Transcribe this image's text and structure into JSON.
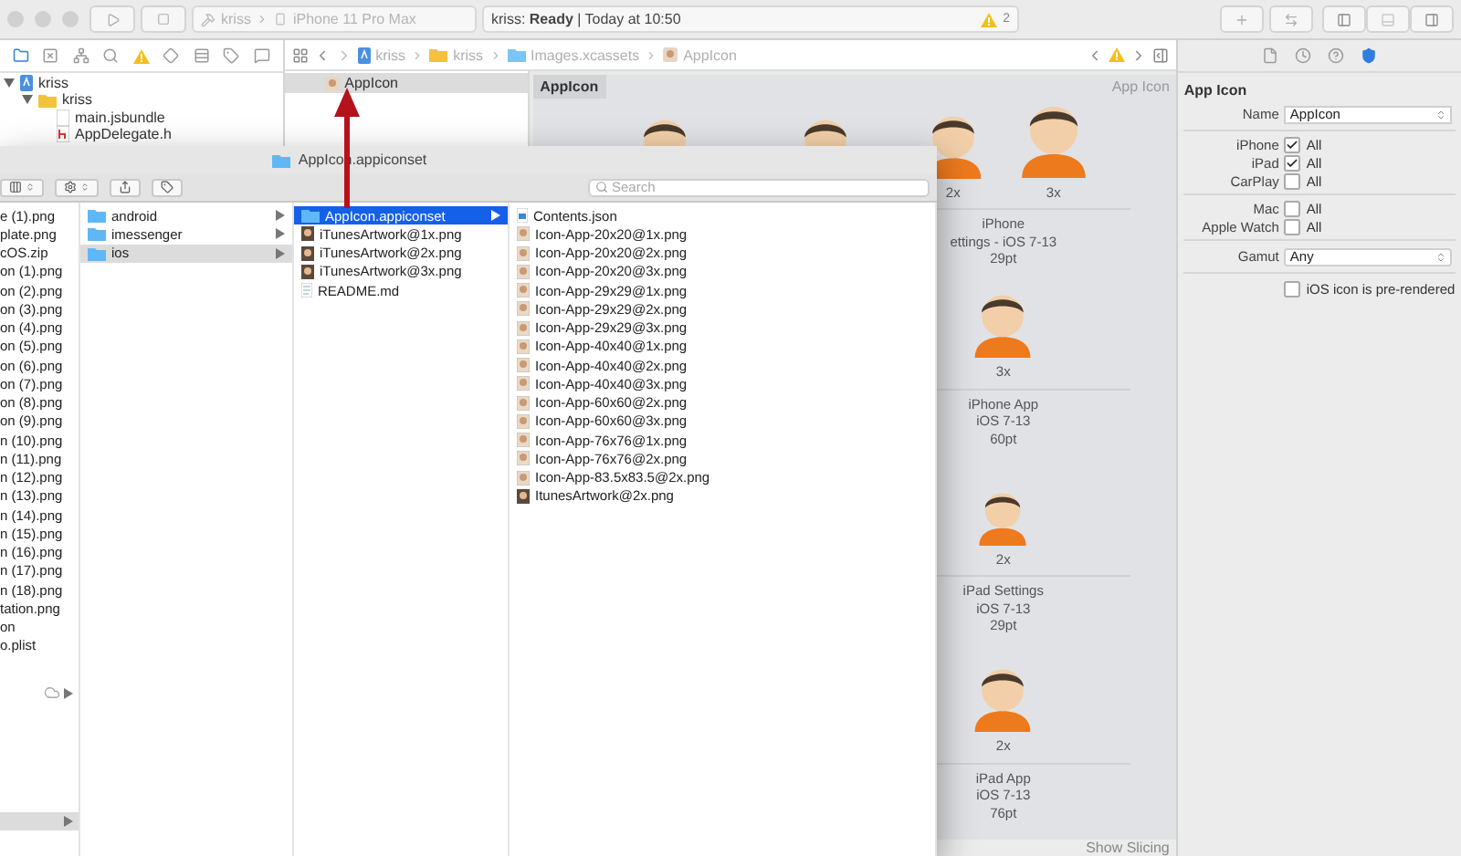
{
  "toolbar": {
    "scheme": "kriss",
    "device": "iPhone 11 Pro Max",
    "status": "kriss: **Ready** | Today at 10:50",
    "warning_count": "2",
    "panel_toggles": [
      {
        "kind": "navigator",
        "on": true
      },
      {
        "kind": "debug",
        "on": false
      },
      {
        "kind": "inspector",
        "on": true
      }
    ]
  },
  "navigator": {
    "tree": [
      {
        "name": "kriss",
        "kind": "project",
        "expanded": true,
        "children": [
          {
            "name": "kriss",
            "kind": "folder",
            "expanded": true,
            "children": [
              {
                "name": "main.jsbundle",
                "kind": "file"
              },
              {
                "name": "AppDelegate.h",
                "kind": "header"
              }
            ]
          }
        ]
      }
    ]
  },
  "jump_bar": {
    "path": [
      {
        "name": "kriss",
        "kind": "project"
      },
      {
        "name": "kriss",
        "kind": "folder"
      },
      {
        "name": "Images.xcassets",
        "kind": "assets"
      },
      {
        "name": "AppIcon",
        "kind": "appicon"
      }
    ]
  },
  "asset_list": [
    {
      "name": "AppIcon",
      "selected": true
    }
  ],
  "asset_detail": {
    "tab": "AppIcon",
    "type_label": "App Icon",
    "footer_button": "Show Slicing",
    "sets": [
      {
        "scales": [
          "2x",
          "3x"
        ],
        "caption": [
          "iPhone",
          "ettings - iOS 7-13",
          "29pt"
        ]
      },
      {
        "scales": [
          "3x"
        ],
        "caption": [
          "iPhone App",
          "iOS 7-13",
          "60pt"
        ]
      },
      {
        "scales": [
          "2x"
        ],
        "caption": [
          "iPad Settings",
          "iOS 7-13",
          "29pt"
        ]
      },
      {
        "scales": [
          "2x"
        ],
        "caption": [
          "iPad App",
          "iOS 7-13",
          "76pt"
        ]
      }
    ]
  },
  "inspector": {
    "section": "App Icon",
    "name_label": "Name",
    "name_value": "AppIcon",
    "platforms": [
      {
        "label": "iPhone",
        "option": "All",
        "checked": true
      },
      {
        "label": "iPad",
        "option": "All",
        "checked": true
      },
      {
        "label": "CarPlay",
        "option": "All",
        "checked": false
      },
      {
        "label": "Mac",
        "option": "All",
        "checked": false
      },
      {
        "label": "Apple Watch",
        "option": "All",
        "checked": false
      }
    ],
    "gamut_label": "Gamut",
    "gamut_value": "Any",
    "prerendered": {
      "label": "iOS icon is pre-rendered",
      "checked": false
    }
  },
  "finder": {
    "title": "AppIcon.appiconset",
    "search_placeholder": "Search",
    "columns": [
      {
        "focused": false,
        "highlighted_row": true,
        "items": [
          {
            "name": "e (1).png",
            "kind": "partial",
            "selected": false
          },
          {
            "name": "plate.png",
            "kind": "partial",
            "selected": false
          },
          {
            "name": "cOS.zip",
            "kind": "partial",
            "selected": false
          },
          {
            "name": "on (1).png",
            "kind": "partial",
            "selected": false
          },
          {
            "name": "on (2).png",
            "kind": "partial",
            "selected": false
          },
          {
            "name": "on (3).png",
            "kind": "partial",
            "selected": false
          },
          {
            "name": "on (4).png",
            "kind": "partial",
            "selected": false
          },
          {
            "name": "on (5).png",
            "kind": "partial",
            "selected": false
          },
          {
            "name": "on (6).png",
            "kind": "partial",
            "selected": false
          },
          {
            "name": "on (7).png",
            "kind": "partial",
            "selected": false
          },
          {
            "name": "on (8).png",
            "kind": "partial",
            "selected": false
          },
          {
            "name": "on (9).png",
            "kind": "partial",
            "selected": false
          },
          {
            "name": "n (10).png",
            "kind": "partial",
            "selected": false
          },
          {
            "name": "n (11).png",
            "kind": "partial",
            "selected": false
          },
          {
            "name": "n (12).png",
            "kind": "partial",
            "selected": false
          },
          {
            "name": "n (13).png",
            "kind": "partial",
            "selected": false
          },
          {
            "name": "n (14).png",
            "kind": "partial",
            "selected": false
          },
          {
            "name": "n (15).png",
            "kind": "partial",
            "selected": false
          },
          {
            "name": "n (16).png",
            "kind": "partial",
            "selected": false
          },
          {
            "name": "n (17).png",
            "kind": "partial",
            "selected": false
          },
          {
            "name": "n (18).png",
            "kind": "partial",
            "selected": false
          },
          {
            "name": "tation.png",
            "kind": "partial",
            "selected": false
          },
          {
            "name": "on",
            "kind": "partial",
            "selected": false
          },
          {
            "name": "o.plist",
            "kind": "partial",
            "selected": false
          }
        ]
      },
      {
        "focused": false,
        "items": [
          {
            "name": "android",
            "kind": "folder",
            "selected": false
          },
          {
            "name": "imessenger",
            "kind": "folder",
            "selected": false
          },
          {
            "name": "ios",
            "kind": "folder",
            "selected": true
          }
        ]
      },
      {
        "focused": true,
        "items": [
          {
            "name": "AppIcon.appiconset",
            "kind": "folder",
            "selected": true
          },
          {
            "name": "iTunesArtwork@1x.png",
            "kind": "artwork",
            "selected": false
          },
          {
            "name": "iTunesArtwork@2x.png",
            "kind": "artwork",
            "selected": false
          },
          {
            "name": "iTunesArtwork@3x.png",
            "kind": "artwork",
            "selected": false
          },
          {
            "name": "README.md",
            "kind": "text",
            "selected": false
          }
        ]
      },
      {
        "items": [
          {
            "name": "Contents.json",
            "kind": "json",
            "selected": false
          },
          {
            "name": "Icon-App-20x20@1x.png",
            "kind": "image",
            "selected": false
          },
          {
            "name": "Icon-App-20x20@2x.png",
            "kind": "image",
            "selected": false
          },
          {
            "name": "Icon-App-20x20@3x.png",
            "kind": "image",
            "selected": false
          },
          {
            "name": "Icon-App-29x29@1x.png",
            "kind": "image",
            "selected": false
          },
          {
            "name": "Icon-App-29x29@2x.png",
            "kind": "image",
            "selected": false
          },
          {
            "name": "Icon-App-29x29@3x.png",
            "kind": "image",
            "selected": false
          },
          {
            "name": "Icon-App-40x40@1x.png",
            "kind": "image",
            "selected": false
          },
          {
            "name": "Icon-App-40x40@2x.png",
            "kind": "image",
            "selected": false
          },
          {
            "name": "Icon-App-40x40@3x.png",
            "kind": "image",
            "selected": false
          },
          {
            "name": "Icon-App-60x60@2x.png",
            "kind": "image",
            "selected": false
          },
          {
            "name": "Icon-App-60x60@3x.png",
            "kind": "image",
            "selected": false
          },
          {
            "name": "Icon-App-76x76@1x.png",
            "kind": "image",
            "selected": false
          },
          {
            "name": "Icon-App-76x76@2x.png",
            "kind": "image",
            "selected": false
          },
          {
            "name": "Icon-App-83.5x83.5@2x.png",
            "kind": "image",
            "selected": false
          },
          {
            "name": "ItunesArtwork@2x.png",
            "kind": "artwork",
            "selected": false
          }
        ]
      }
    ]
  }
}
